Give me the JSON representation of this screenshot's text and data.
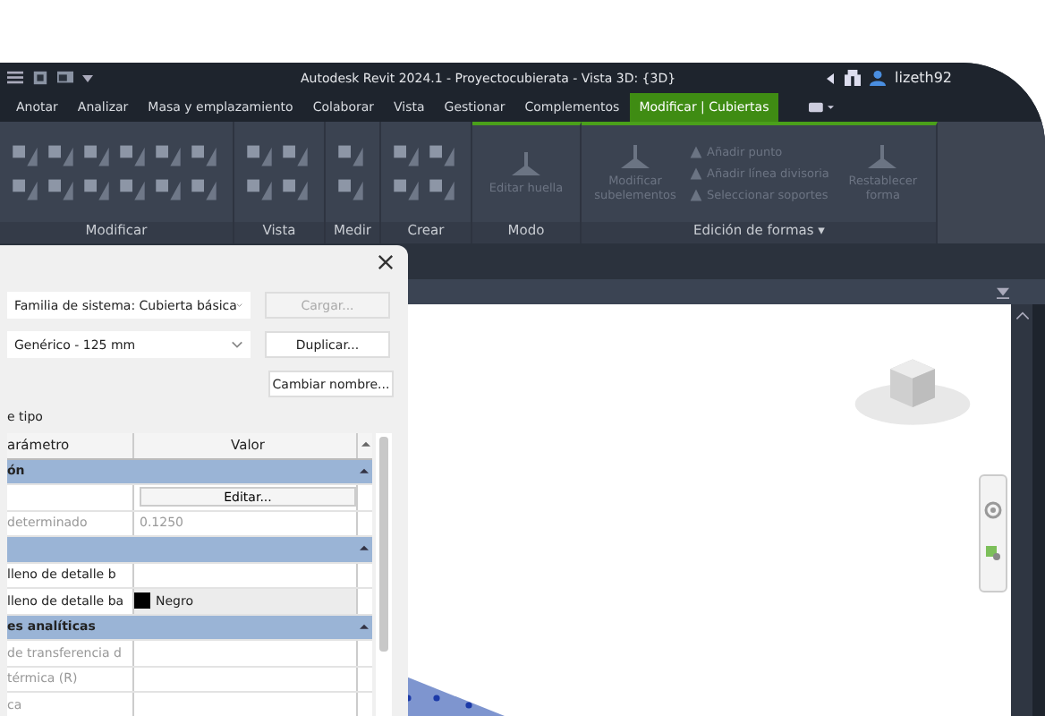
{
  "window": {
    "title": "Autodesk Revit 2024.1 - Proyectocubierata - Vista 3D: {3D}",
    "user": "lizeth92"
  },
  "tabs": [
    {
      "label": "Anotar",
      "selected": false
    },
    {
      "label": "Analizar",
      "selected": false
    },
    {
      "label": "Masa y emplazamiento",
      "selected": false
    },
    {
      "label": "Colaborar",
      "selected": false
    },
    {
      "label": "Vista",
      "selected": false
    },
    {
      "label": "Gestionar",
      "selected": false
    },
    {
      "label": "Complementos",
      "selected": false
    },
    {
      "label": "Modificar | Cubiertas",
      "selected": true
    }
  ],
  "ribbon": {
    "panels": [
      {
        "label": "Modificar"
      },
      {
        "label": "Vista"
      },
      {
        "label": "Medir"
      },
      {
        "label": "Crear"
      },
      {
        "label": "Modo",
        "buttons": [
          {
            "kind": "large",
            "label": "Editar huella",
            "disabled": true
          }
        ]
      },
      {
        "label": "Edición de formas ▾",
        "buttons": [
          {
            "kind": "large",
            "label": "Modificar subelementos",
            "disabled": true
          },
          {
            "kind": "small",
            "label": "Añadir punto",
            "disabled": true
          },
          {
            "kind": "small",
            "label": "Añadir línea divisoria",
            "disabled": true
          },
          {
            "kind": "small",
            "label": "Seleccionar soportes",
            "disabled": true
          },
          {
            "kind": "large",
            "label": "Restablecer forma",
            "disabled": true
          }
        ]
      }
    ]
  },
  "dialog": {
    "family": "Familia de sistema: Cubierta básica",
    "type": "Genérico - 125 mm",
    "buttons": [
      {
        "label": "Cargar...",
        "disabled": true
      },
      {
        "label": "Duplicar...",
        "disabled": false
      },
      {
        "label": "Cambiar nombre...",
        "disabled": false
      }
    ],
    "section_label": "e tipo",
    "columns": [
      "arámetro",
      "Valor"
    ],
    "rows": [
      {
        "kind": "group",
        "name": "ón"
      },
      {
        "kind": "button",
        "value": "Editar..."
      },
      {
        "kind": "param",
        "name": "determinado",
        "value": "0.1250",
        "disabled": true
      },
      {
        "kind": "group"
      },
      {
        "kind": "param",
        "name": "lleno de detalle b",
        "disabled": false
      },
      {
        "kind": "color",
        "name": "lleno de detalle ba",
        "value": "Negro",
        "color": "#000000"
      },
      {
        "kind": "group",
        "name": "es analíticas"
      },
      {
        "kind": "param",
        "name": "de transferencia d",
        "disabled": true
      },
      {
        "kind": "param",
        "name": "térmica (R)",
        "disabled": true
      },
      {
        "kind": "param",
        "name": "ca",
        "disabled": true
      }
    ]
  }
}
